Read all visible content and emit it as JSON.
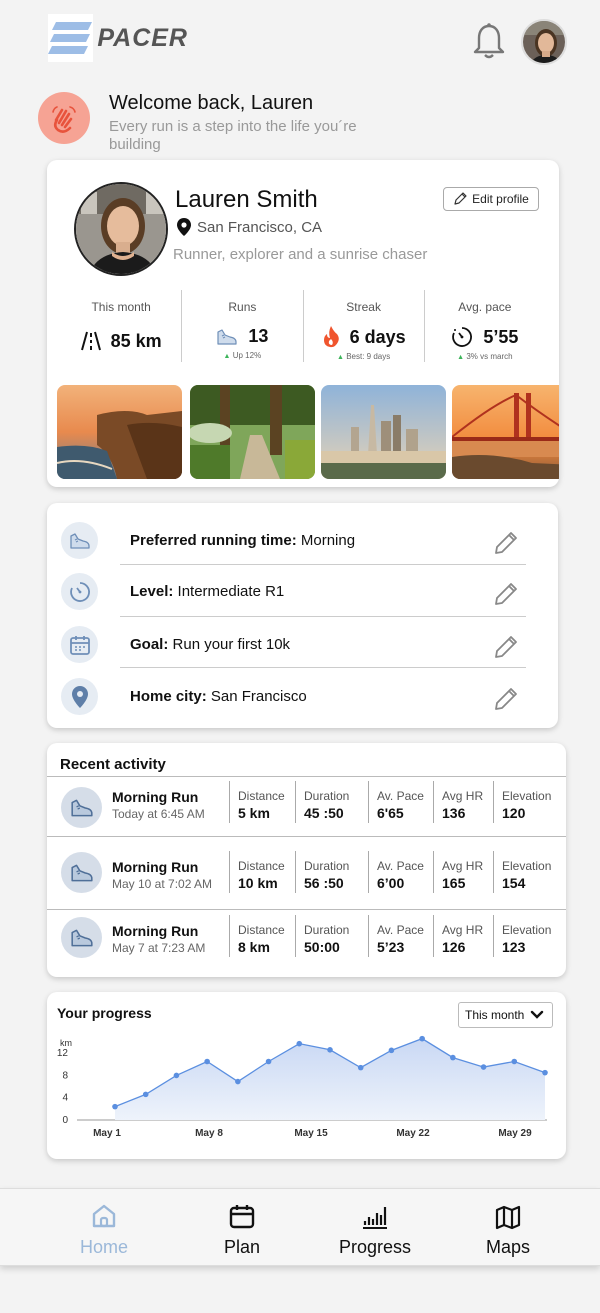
{
  "header": {
    "logo_text": "PACER"
  },
  "welcome": {
    "title": "Welcome back, Lauren",
    "subtitle": "Every run is a step into the life you´re building"
  },
  "profile": {
    "name": "Lauren Smith",
    "location": "San Francisco, CA",
    "bio": "Runner, explorer and a sunrise chaser",
    "edit_label": "Edit profile",
    "stats": [
      {
        "label": "This month",
        "value": "85 km",
        "sub": ""
      },
      {
        "label": "Runs",
        "value": "13",
        "sub": "Up 12%"
      },
      {
        "label": "Streak",
        "value": "6 days",
        "sub": "Best: 9 days"
      },
      {
        "label": "Avg. pace",
        "value": "5’55",
        "sub": "3% vs march"
      }
    ]
  },
  "preferences": [
    {
      "label": "Preferred running time:",
      "value": "Morning",
      "icon": "shoe-icon"
    },
    {
      "label": "Level:",
      "value": "Intermediate R1",
      "icon": "timer-icon"
    },
    {
      "label": "Goal:",
      "value": "Run your first 10k",
      "icon": "calendar-icon"
    },
    {
      "label": "Home city:",
      "value": "San Francisco",
      "icon": "location-pin-icon"
    }
  ],
  "activity": {
    "title": "Recent activity",
    "columns": [
      "Distance",
      "Duration",
      "Av. Pace",
      "Avg HR",
      "Elevation"
    ],
    "rows": [
      {
        "name": "Morning Run",
        "when": "Today at 6:45 AM",
        "values": [
          "5 km",
          "45 :50",
          "6'65",
          "136",
          "120"
        ]
      },
      {
        "name": "Morning Run",
        "when": "May 10 at 7:02 AM",
        "values": [
          "10 km",
          "56 :50",
          "6’00",
          "165",
          "154"
        ]
      },
      {
        "name": "Morning Run",
        "when": "May 7 at 7:23 AM",
        "values": [
          "8 km",
          "50:00",
          "5’23",
          "126",
          "123"
        ]
      }
    ]
  },
  "progress": {
    "title": "Your progress",
    "period": "This month"
  },
  "chart_data": {
    "type": "area",
    "title": "",
    "xlabel": "",
    "ylabel": "km",
    "ylim": [
      0,
      14
    ],
    "yticks": [
      0,
      4,
      8,
      12
    ],
    "x_tick_labels": [
      "May 1",
      "May 8",
      "May 15",
      "May 22",
      "May 29"
    ],
    "x": [
      1,
      2.5,
      4,
      6,
      8,
      9.5,
      11,
      13,
      14.5,
      16,
      18,
      20,
      21.5,
      23,
      24.5,
      26,
      27.5,
      29
    ],
    "values": [
      2.4,
      4.6,
      8.0,
      10.5,
      6.9,
      10.5,
      13.7,
      12.6,
      9.4,
      12.5,
      14.6,
      11.2,
      9.5,
      10.5,
      8.5
    ],
    "grid": false,
    "color": "#5b8fe0"
  },
  "nav": [
    {
      "label": "Home",
      "icon": "home-icon",
      "active": true
    },
    {
      "label": "Plan",
      "icon": "calendar-icon",
      "active": false
    },
    {
      "label": "Progress",
      "icon": "chart-icon",
      "active": false
    },
    {
      "label": "Maps",
      "icon": "map-icon",
      "active": false
    }
  ]
}
